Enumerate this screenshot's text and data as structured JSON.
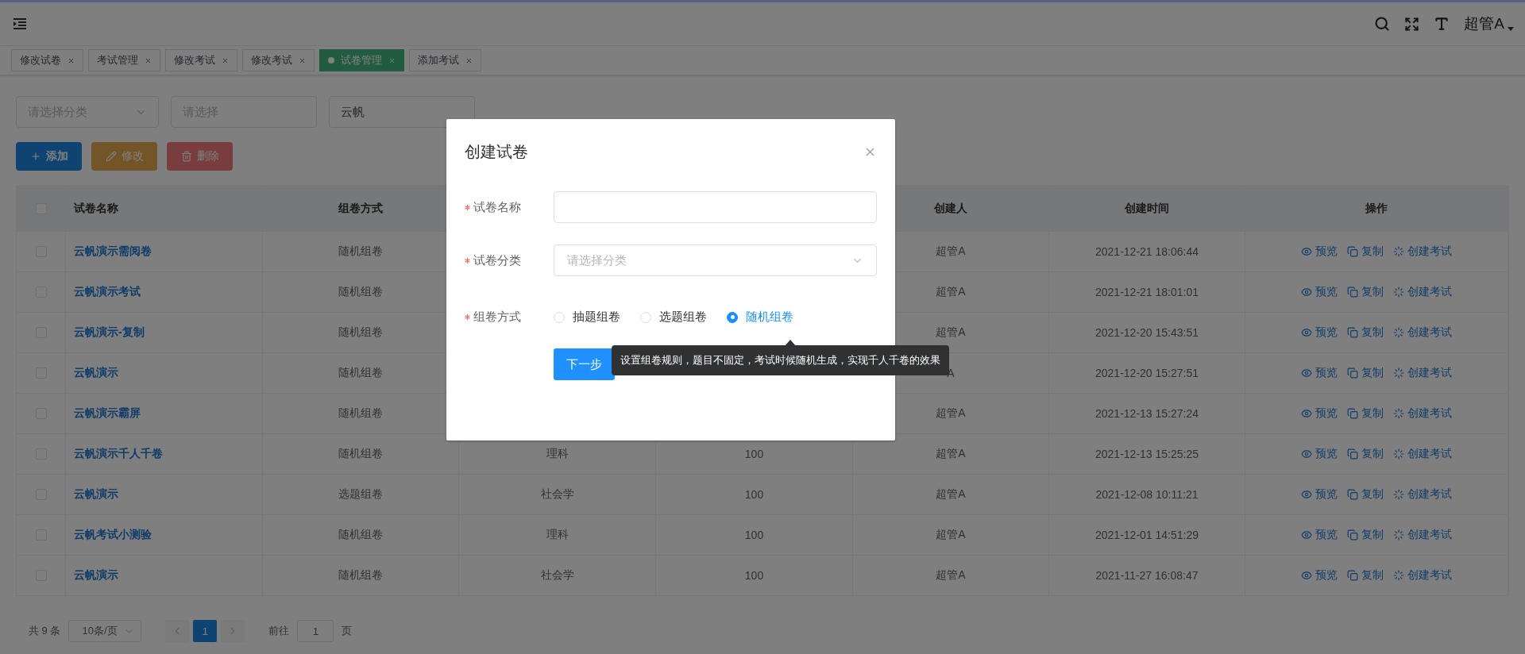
{
  "header": {
    "user": "超管A"
  },
  "tabs": [
    {
      "label": "修改试卷",
      "selected": false
    },
    {
      "label": "考试管理",
      "selected": false
    },
    {
      "label": "修改考试",
      "selected": false
    },
    {
      "label": "修改考试",
      "selected": false
    },
    {
      "label": "试卷管理",
      "selected": true
    },
    {
      "label": "添加考试",
      "selected": false
    }
  ],
  "filters": [
    {
      "kind": "select",
      "placeholder": "请选择分类"
    },
    {
      "kind": "input",
      "placeholder": "请选择"
    },
    {
      "kind": "input",
      "value": "云帆"
    }
  ],
  "actions": [
    {
      "kind": "add",
      "label": "添加",
      "disabled": false
    },
    {
      "kind": "edit",
      "label": "修改",
      "disabled": true
    },
    {
      "kind": "delete",
      "label": "删除",
      "disabled": true
    }
  ],
  "table": {
    "header": {
      "checked": false,
      "column_1": "试卷名称",
      "column_2": "组卷方式",
      "column_5": "创建人",
      "column_6": "创建时间",
      "column_7": "操作"
    },
    "rows": [
      {
        "checked": false,
        "name": "云帆演示需阅卷",
        "method": "随机组卷",
        "creator": "超管A",
        "created": "2021-12-21 18:06:44",
        "actions": [
          "预览",
          "复制",
          "创建考试"
        ]
      },
      {
        "checked": false,
        "name": "云帆演示考试",
        "method": "随机组卷",
        "creator": "超管A",
        "created": "2021-12-21 18:01:01",
        "actions": [
          "预览",
          "复制",
          "创建考试"
        ]
      },
      {
        "checked": false,
        "name": "云帆演示-复制",
        "method": "随机组卷",
        "creator": "超管A",
        "created": "2021-12-20 15:43:51",
        "actions": [
          "预览",
          "复制",
          "创建考试"
        ]
      },
      {
        "checked": false,
        "name": "云帆演示",
        "method": "随机组卷",
        "creator": "A",
        "created": "2021-12-20 15:27:51",
        "actions": [
          "预览",
          "复制",
          "创建考试"
        ]
      },
      {
        "checked": false,
        "name": "云帆演示霸屏",
        "method": "随机组卷",
        "creator": "超管A",
        "created": "2021-12-13 15:27:24",
        "actions": [
          "预览",
          "复制",
          "创建考试"
        ]
      },
      {
        "checked": false,
        "name": "云帆演示千人千卷",
        "method": "随机组卷",
        "column_3": "理科",
        "column_4": "100",
        "creator": "超管A",
        "created": "2021-12-13 15:25:25",
        "actions": [
          "预览",
          "复制",
          "创建考试"
        ]
      },
      {
        "checked": false,
        "name": "云帆演示",
        "method": "选题组卷",
        "column_3": "社会学",
        "column_4": "100",
        "creator": "超管A",
        "created": "2021-12-08 10:11:21",
        "actions": [
          "预览",
          "复制",
          "创建考试"
        ]
      },
      {
        "checked": false,
        "name": "云帆考试小测验",
        "method": "随机组卷",
        "column_3": "理科",
        "column_4": "100",
        "creator": "超管A",
        "created": "2021-12-01 14:51:29",
        "actions": [
          "预览",
          "复制",
          "创建考试"
        ]
      },
      {
        "checked": false,
        "name": "云帆演示",
        "method": "随机组卷",
        "column_3": "社会学",
        "column_4": "100",
        "creator": "超管A",
        "created": "2021-11-27 16:08:47",
        "actions": [
          "预览",
          "复制",
          "创建考试"
        ]
      }
    ]
  },
  "pagination": {
    "total": "共 9 条",
    "page_size": "10条/页",
    "pages": [
      {
        "label": "1",
        "selected": true
      }
    ],
    "goto_label": "前往",
    "goto_value": "1",
    "page_suffix": "页"
  },
  "modal": {
    "title": "创建试卷",
    "fields": [
      {
        "kind": "input",
        "label": "试卷名称",
        "required": true
      },
      {
        "kind": "select",
        "label": "试卷分类",
        "required": true,
        "placeholder": "请选择分类"
      },
      {
        "kind": "radio",
        "label": "组卷方式",
        "required": true,
        "options": [
          {
            "label": "抽题组卷",
            "selected": false
          },
          {
            "label": "选题组卷",
            "selected": false
          },
          {
            "label": "随机组卷",
            "selected": true
          }
        ]
      }
    ],
    "tooltip": "设置组卷规则，题目不固定，考试时候随机生成，实现千人千卷的效果",
    "submit": "下一步"
  }
}
